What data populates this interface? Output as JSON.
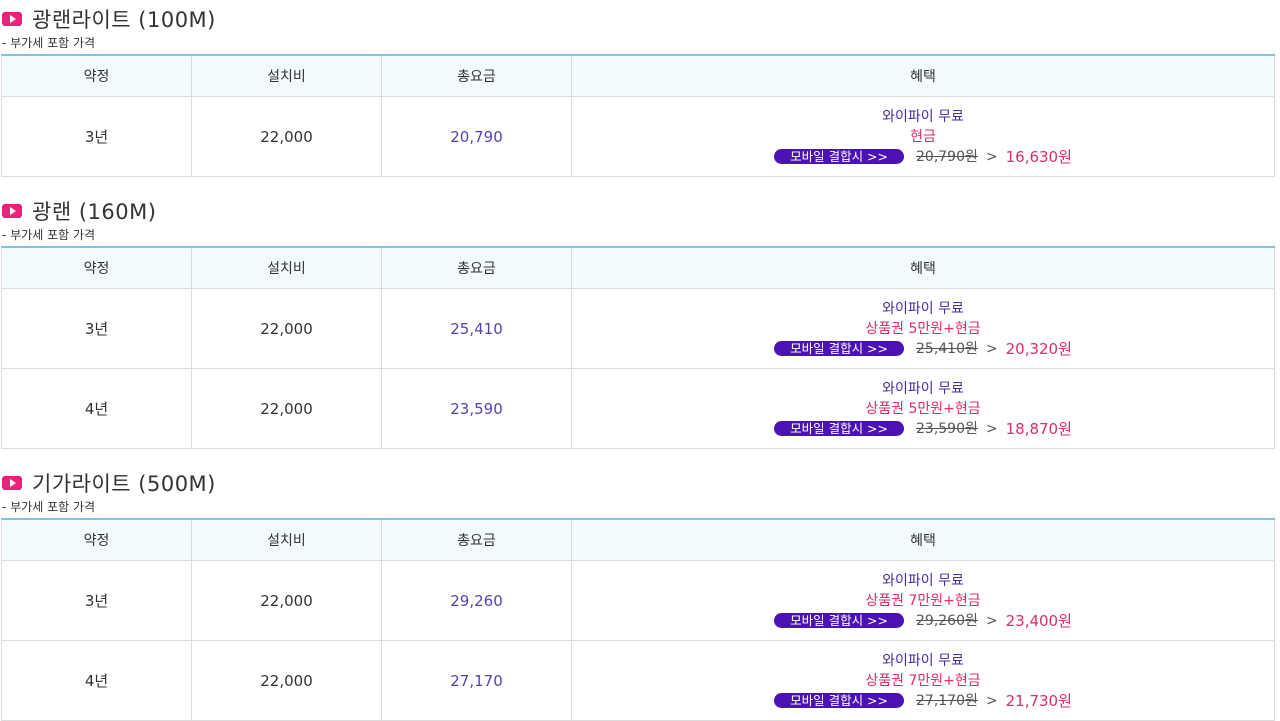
{
  "headers": {
    "term": "약정",
    "install": "설치비",
    "total": "총요금",
    "benefit": "혜택"
  },
  "vat_note": "- 부가세 포함 가격",
  "mobile_label": "모바일 결합시 >>",
  "sections": [
    {
      "title": "광랜라이트 (100M)",
      "rows": [
        {
          "term": "3년",
          "install": "22,000",
          "total": "20,790",
          "wifi": "와이파이 무료",
          "gift": "현금",
          "old": "20,790원",
          "arrow": ">",
          "new": "16,630원"
        }
      ]
    },
    {
      "title": "광랜 (160M)",
      "rows": [
        {
          "term": "3년",
          "install": "22,000",
          "total": "25,410",
          "wifi": "와이파이 무료",
          "gift": "상품권 5만원+현금",
          "old": "25,410원",
          "arrow": ">",
          "new": "20,320원"
        },
        {
          "term": "4년",
          "install": "22,000",
          "total": "23,590",
          "wifi": "와이파이 무료",
          "gift": "상품권 5만원+현금",
          "old": "23,590원",
          "arrow": ">",
          "new": "18,870원"
        }
      ]
    },
    {
      "title": "기가라이트 (500M)",
      "rows": [
        {
          "term": "3년",
          "install": "22,000",
          "total": "29,260",
          "wifi": "와이파이 무료",
          "gift": "상품권 7만원+현금",
          "old": "29,260원",
          "arrow": ">",
          "new": "23,400원"
        },
        {
          "term": "4년",
          "install": "22,000",
          "total": "27,170",
          "wifi": "와이파이 무료",
          "gift": "상품권 7만원+현금",
          "old": "27,170원",
          "arrow": ">",
          "new": "21,730원"
        }
      ]
    }
  ],
  "colors": {
    "accent": "#e8237c",
    "badge": "#4c13b0",
    "price": "#5b3fb0",
    "discount": "#e02a6d",
    "header_line": "#7cc3e8"
  },
  "icon": "play-icon"
}
